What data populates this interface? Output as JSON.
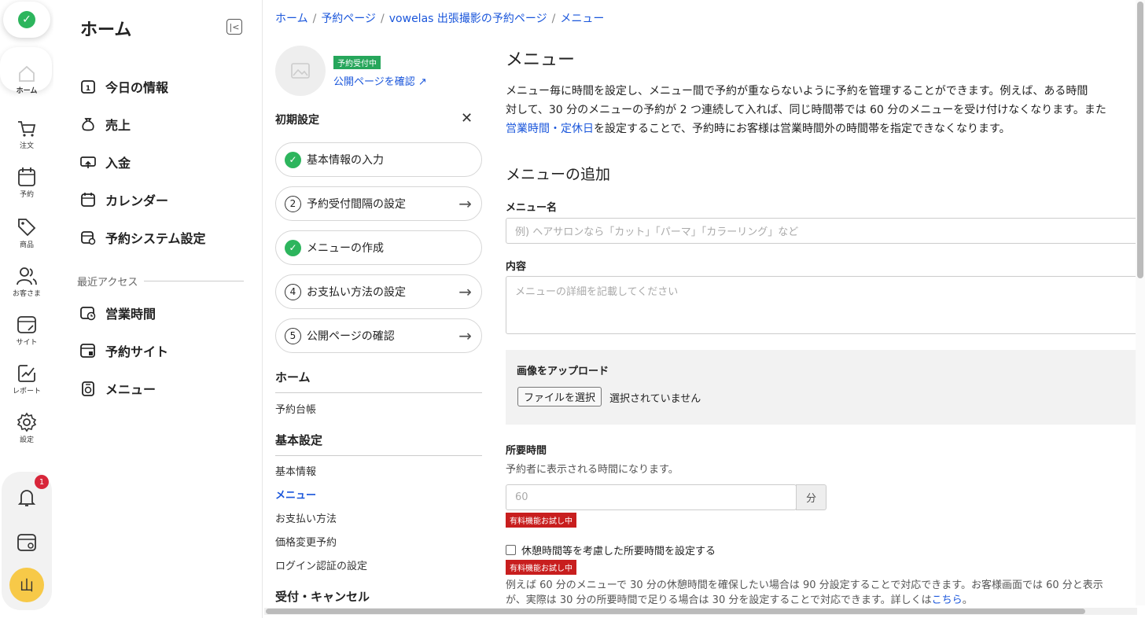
{
  "rail": {
    "items": [
      {
        "label": "ホーム",
        "icon": "home-icon"
      },
      {
        "label": "注文",
        "icon": "cart-icon"
      },
      {
        "label": "予約",
        "icon": "calendar-icon"
      },
      {
        "label": "商品",
        "icon": "tag-icon"
      },
      {
        "label": "お客さま",
        "icon": "users-icon"
      },
      {
        "label": "サイト",
        "icon": "site-icon"
      },
      {
        "label": "レポート",
        "icon": "report-icon"
      },
      {
        "label": "設定",
        "icon": "gear-icon"
      }
    ],
    "notification_count": "1",
    "avatar_text": "山"
  },
  "nav": {
    "title": "ホーム",
    "items": [
      {
        "label": "今日の情報",
        "icon": "today-icon"
      },
      {
        "label": "売上",
        "icon": "money-bag-icon"
      },
      {
        "label": "入金",
        "icon": "deposit-icon"
      },
      {
        "label": "カレンダー",
        "icon": "calendar-icon"
      },
      {
        "label": "予約システム設定",
        "icon": "calendar-settings-icon"
      }
    ],
    "recent_label": "最近アクセス",
    "recent_items": [
      {
        "label": "営業時間",
        "icon": "clock-icon"
      },
      {
        "label": "予約サイト",
        "icon": "site-icon"
      },
      {
        "label": "メニュー",
        "icon": "menu-icon"
      }
    ]
  },
  "breadcrumb": [
    "ホーム",
    "予約ページ",
    "vowelas 出張撮影の予約ページ",
    "メニュー"
  ],
  "mid": {
    "status": "予約受付中",
    "public_link": "公開ページを確認",
    "init_title": "初期設定",
    "steps": [
      {
        "marker": "✓",
        "done": true,
        "label": "基本情報の入力"
      },
      {
        "marker": "2",
        "done": false,
        "label": "予約受付間隔の設定"
      },
      {
        "marker": "✓",
        "done": true,
        "label": "メニューの作成"
      },
      {
        "marker": "4",
        "done": false,
        "label": "お支払い方法の設定"
      },
      {
        "marker": "5",
        "done": false,
        "label": "公開ページの確認"
      }
    ],
    "sec_home": "ホーム",
    "home_items": [
      "予約台帳"
    ],
    "sec_basic": "基本設定",
    "basic_items": [
      "基本情報",
      "メニュー",
      "お支払い方法",
      "価格変更予約",
      "ログイン認証の設定"
    ],
    "sec_cancel": "受付・キャンセル"
  },
  "main": {
    "title": "メニュー",
    "desc_line1": "メニュー毎に時間を設定し、メニュー間で予約が重ならないように予約を管理することができます。例えば、ある時間",
    "desc_line2": "対して、30 分のメニューの予約が 2 つ連続して入れば、同じ時間帯では 60 分のメニューを受け付けなくなります。また",
    "desc_link": "営業時間・定休日",
    "desc_line3": "を設定することで、予約時にお客様は営業時間外の時間帯を指定できなくなります。",
    "add_title": "メニューの追加",
    "name_label": "メニュー名",
    "name_placeholder": "例) ヘアサロンなら「カット」「パーマ」「カラーリング」など",
    "content_label": "内容",
    "content_placeholder": "メニューの詳細を記載してください",
    "upload_label": "画像をアップロード",
    "file_button": "ファイルを選択",
    "file_none": "選択されていません",
    "duration_label": "所要時間",
    "duration_hint": "予約者に表示される時間になります。",
    "duration_placeholder": "60",
    "duration_unit": "分",
    "paid_badge": "有料機能お試し中",
    "checkbox_label": "休憩時間等を考慮した所要時間を設定する",
    "foot_line1": "例えば 60 分のメニューで 30 分の休憩時間を確保したい場合は 90 分設定することで対応できます。お客様画面では 60 分と表示",
    "foot_line2": "が、実際は 30 分の所要時間で足りる場合は 30 分を設定することで対応できます。詳しくは",
    "foot_link": "こちら",
    "foot_end": "。"
  }
}
